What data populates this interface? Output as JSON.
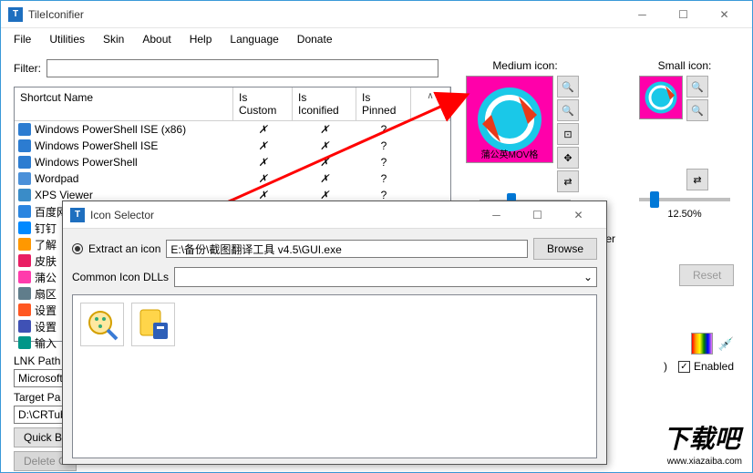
{
  "main": {
    "title": "TileIconifier",
    "menus": [
      "File",
      "Utilities",
      "Skin",
      "About",
      "Help",
      "Language",
      "Donate"
    ],
    "filter_label": "Filter:",
    "filter_value": ""
  },
  "table": {
    "headers": {
      "name": "Shortcut Name",
      "custom": "Is Custom",
      "iconified": "Is Iconified",
      "pinned": "Is Pinned"
    },
    "rows": [
      {
        "name": "Windows PowerShell ISE (x86)",
        "custom": "✗",
        "iconified": "✗",
        "pinned": "?",
        "color": "#2c7cd1"
      },
      {
        "name": "Windows PowerShell ISE",
        "custom": "✗",
        "iconified": "✗",
        "pinned": "?",
        "color": "#2c7cd1"
      },
      {
        "name": "Windows PowerShell",
        "custom": "✗",
        "iconified": "✗",
        "pinned": "?",
        "color": "#2c7cd1"
      },
      {
        "name": "Wordpad",
        "custom": "✗",
        "iconified": "✗",
        "pinned": "?",
        "color": "#4a90d9"
      },
      {
        "name": "XPS Viewer",
        "custom": "✗",
        "iconified": "✗",
        "pinned": "?",
        "color": "#3a8cc8"
      },
      {
        "name": "百度网盘",
        "custom": "✗",
        "iconified": "✗",
        "pinned": "?",
        "color": "#2a85e0"
      },
      {
        "name": "钉钉",
        "custom": "",
        "iconified": "",
        "pinned": "",
        "color": "#0089ff"
      },
      {
        "name": "了解",
        "custom": "",
        "iconified": "",
        "pinned": "",
        "color": "#ff9800"
      },
      {
        "name": "皮肤",
        "custom": "",
        "iconified": "",
        "pinned": "",
        "color": "#e91e63"
      },
      {
        "name": "蒲公",
        "custom": "",
        "iconified": "",
        "pinned": "",
        "color": "#ff3cac"
      },
      {
        "name": "扇区",
        "custom": "",
        "iconified": "",
        "pinned": "",
        "color": "#607d8b"
      },
      {
        "name": "设置",
        "custom": "",
        "iconified": "",
        "pinned": "",
        "color": "#ff5722"
      },
      {
        "name": "设置",
        "custom": "",
        "iconified": "",
        "pinned": "",
        "color": "#3f51b5"
      },
      {
        "name": "输入",
        "custom": "",
        "iconified": "",
        "pinned": "",
        "color": "#009688"
      }
    ]
  },
  "right": {
    "medium_label": "Medium icon:",
    "small_label": "Small icon:",
    "medium_caption": "蒲公英MOV格",
    "small_percent": "12.50%",
    "together_label": "together",
    "reset_label": "Reset",
    "enabled_label": "Enabled"
  },
  "lower": {
    "lnk_path_label": "LNK Path",
    "lnk_path_value": "Microsoft\\",
    "target_path_label": "Target Pa",
    "target_path_value": "D:\\CRTube",
    "quick_build": "Quick Bu",
    "delete": "Delete C"
  },
  "dialog": {
    "title": "Icon Selector",
    "extract_label": "Extract an icon",
    "path_value": "E:\\备份\\截图翻译工具 v4.5\\GUI.exe",
    "browse_label": "Browse",
    "common_label": "Common Icon DLLs",
    "common_value": ""
  },
  "watermark": {
    "text": "下载吧",
    "url": "www.xiazaiba.com"
  }
}
